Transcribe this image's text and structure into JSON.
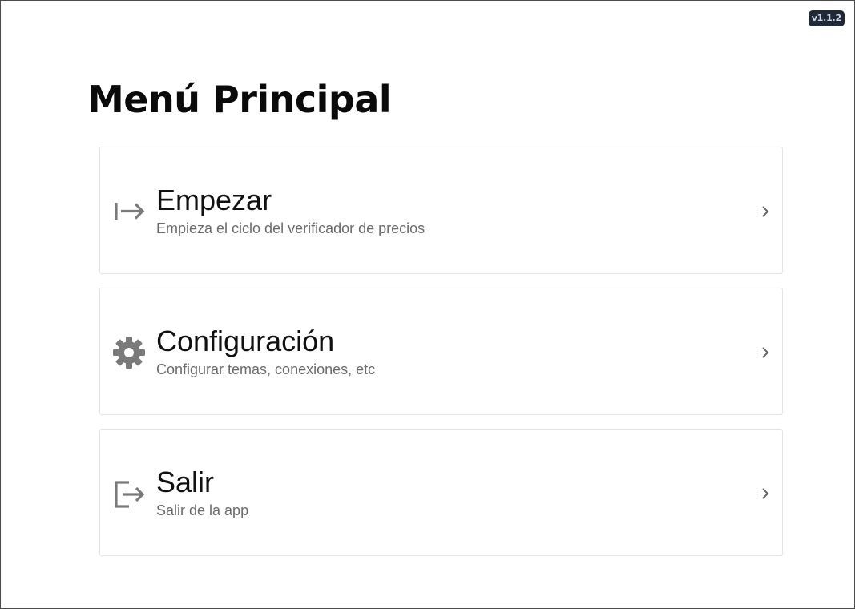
{
  "version": "v1.1.2",
  "page_title": "Menú Principal",
  "menu": {
    "items": [
      {
        "title": "Empezar",
        "subtitle": "Empieza el ciclo del verificador de precios",
        "icon": "start-arrow-icon"
      },
      {
        "title": "Configuración",
        "subtitle": "Configurar temas, conexiones, etc",
        "icon": "gear-icon"
      },
      {
        "title": "Salir",
        "subtitle": "Salir de la app",
        "icon": "logout-icon"
      }
    ]
  },
  "colors": {
    "icon": "#7a7a7a",
    "badge_bg": "#1f2937",
    "border": "#e3e3e3",
    "subtitle": "#6b6b6b"
  }
}
